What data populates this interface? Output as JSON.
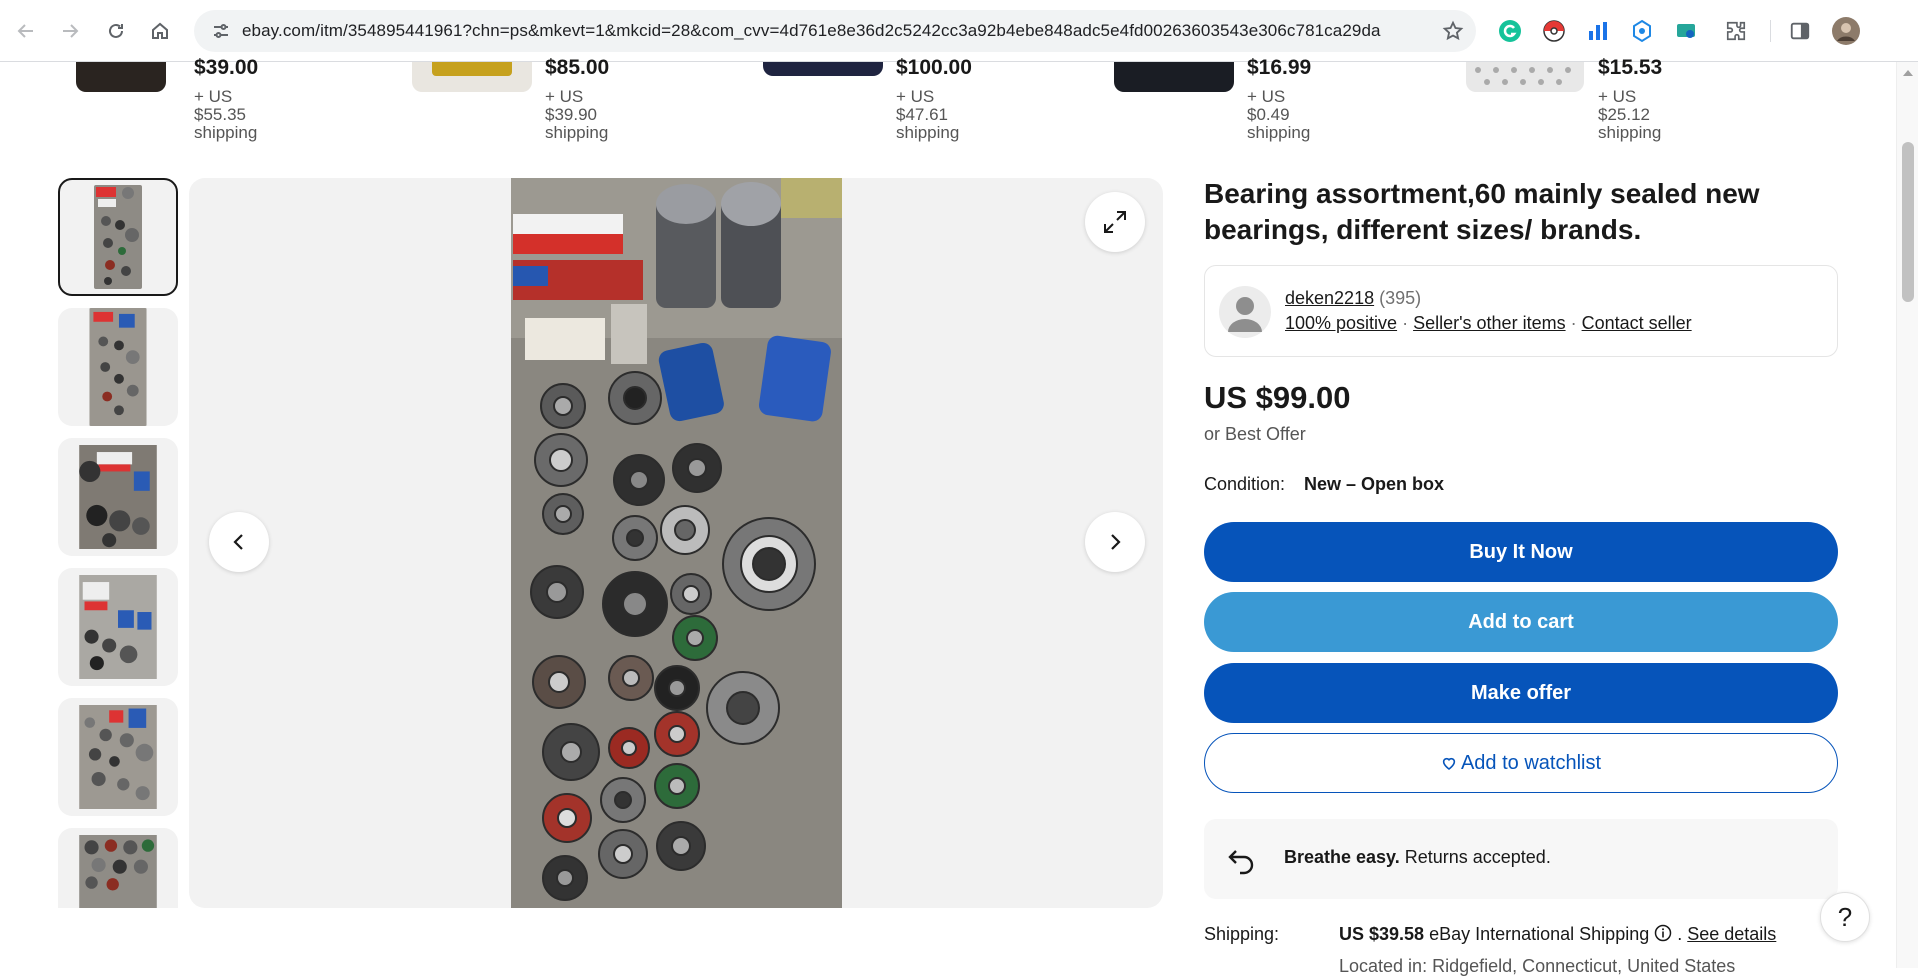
{
  "browser": {
    "url": "ebay.com/itm/354895441961?chn=ps&mkevt=1&mkcid=28&com_cvv=4d761e8e36d2c5242cc3a92b4ebe848adc5e4fd00263603543e306c781ca29da"
  },
  "similar_items": [
    {
      "price": "$39.00",
      "shipping": "+ US $55.35",
      "shipping_word": "shipping"
    },
    {
      "price": "$85.00",
      "shipping": "+ US $39.90",
      "shipping_word": "shipping"
    },
    {
      "price": "$100.00",
      "shipping": "+ US $47.61",
      "shipping_word": "shipping"
    },
    {
      "price": "$16.99",
      "shipping": "+ US $0.49",
      "shipping_word": "shipping"
    },
    {
      "price": "$15.53",
      "shipping": "+ US $25.12",
      "shipping_word": "shipping"
    }
  ],
  "listing": {
    "title": "Bearing assortment,60 mainly sealed new bearings, different sizes/ brands.",
    "seller": {
      "name": "deken2218",
      "count": "(395)",
      "positive": "100% positive",
      "other_items": "Seller's other items",
      "contact": "Contact seller"
    },
    "price": "US $99.00",
    "best_offer": "or Best Offer",
    "condition_label": "Condition:",
    "condition_value": "New – Open box",
    "buttons": {
      "buy": "Buy It Now",
      "cart": "Add to cart",
      "offer": "Make offer",
      "watch": "Add to watchlist"
    },
    "returns": {
      "bold": "Breathe easy.",
      "rest": " Returns accepted."
    },
    "shipping": {
      "label": "Shipping:",
      "amount": "US $39.58",
      "method": " eBay International Shipping ",
      "see_details": "See details",
      "located": "Located in: Ridgefield, Connecticut, United States"
    }
  },
  "help": "?"
}
